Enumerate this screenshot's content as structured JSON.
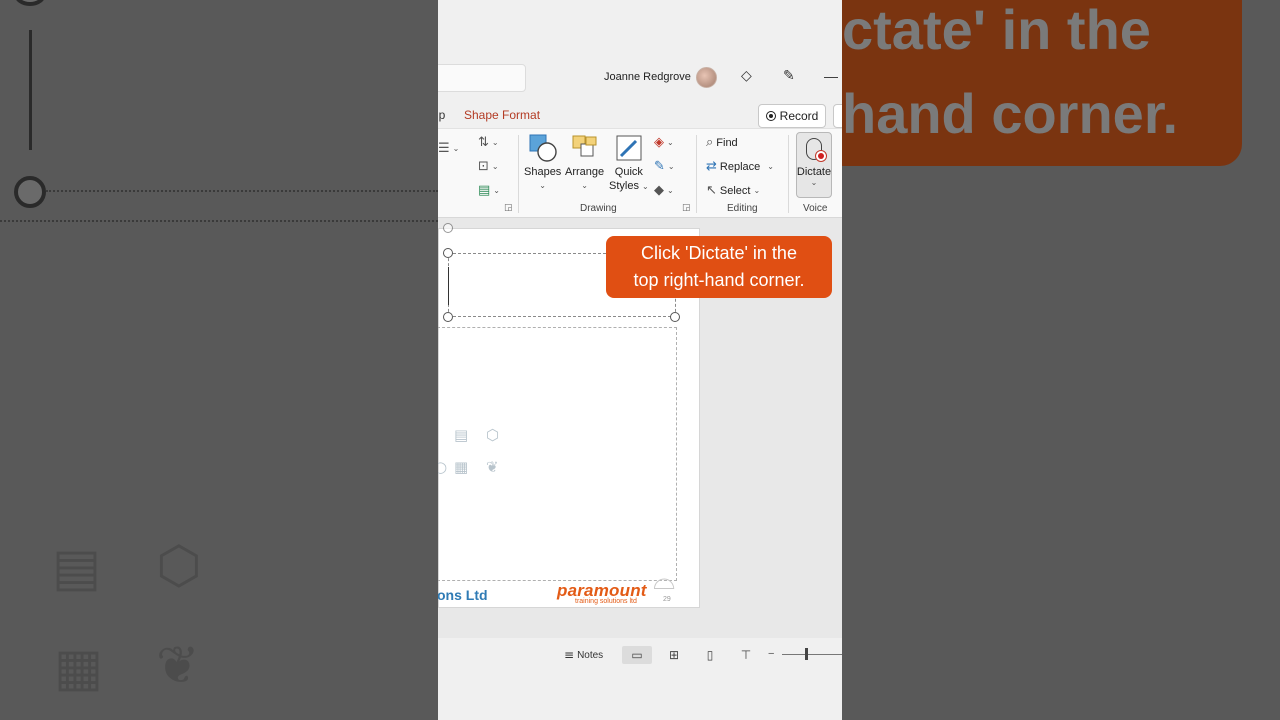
{
  "titlebar": {
    "user_name": "Joanne Redgrove",
    "minimize_glyph": "—"
  },
  "tabs": {
    "partial_tab": "lp",
    "active_tab": "Shape Format",
    "record_label": "Record"
  },
  "ribbon": {
    "shapes_label": "Shapes",
    "arrange_label": "Arrange",
    "quick_styles_line1": "Quick",
    "quick_styles_line2": "Styles",
    "drawing_group": "Drawing",
    "find_label": "Find",
    "replace_label": "Replace",
    "select_label": "Select",
    "editing_group": "Editing",
    "dictate_label": "Dictate",
    "voice_group": "Voice"
  },
  "slide": {
    "footer_text": "ons Ltd",
    "logo_text": "paramount",
    "logo_subtext": "training solutions ltd",
    "page_number": "29"
  },
  "callout": {
    "line1": "Click 'Dictate' in the",
    "line2": "top right-hand corner."
  },
  "statusbar": {
    "notes_label": "Notes"
  },
  "background": {
    "right_line1": "ctate' in the",
    "right_line2": "hand corner."
  },
  "colors": {
    "accent_tab": "#b33b24",
    "callout_bg": "#e04f13",
    "logo_orange": "#e35b16",
    "footer_blue": "#2f7bb5"
  }
}
